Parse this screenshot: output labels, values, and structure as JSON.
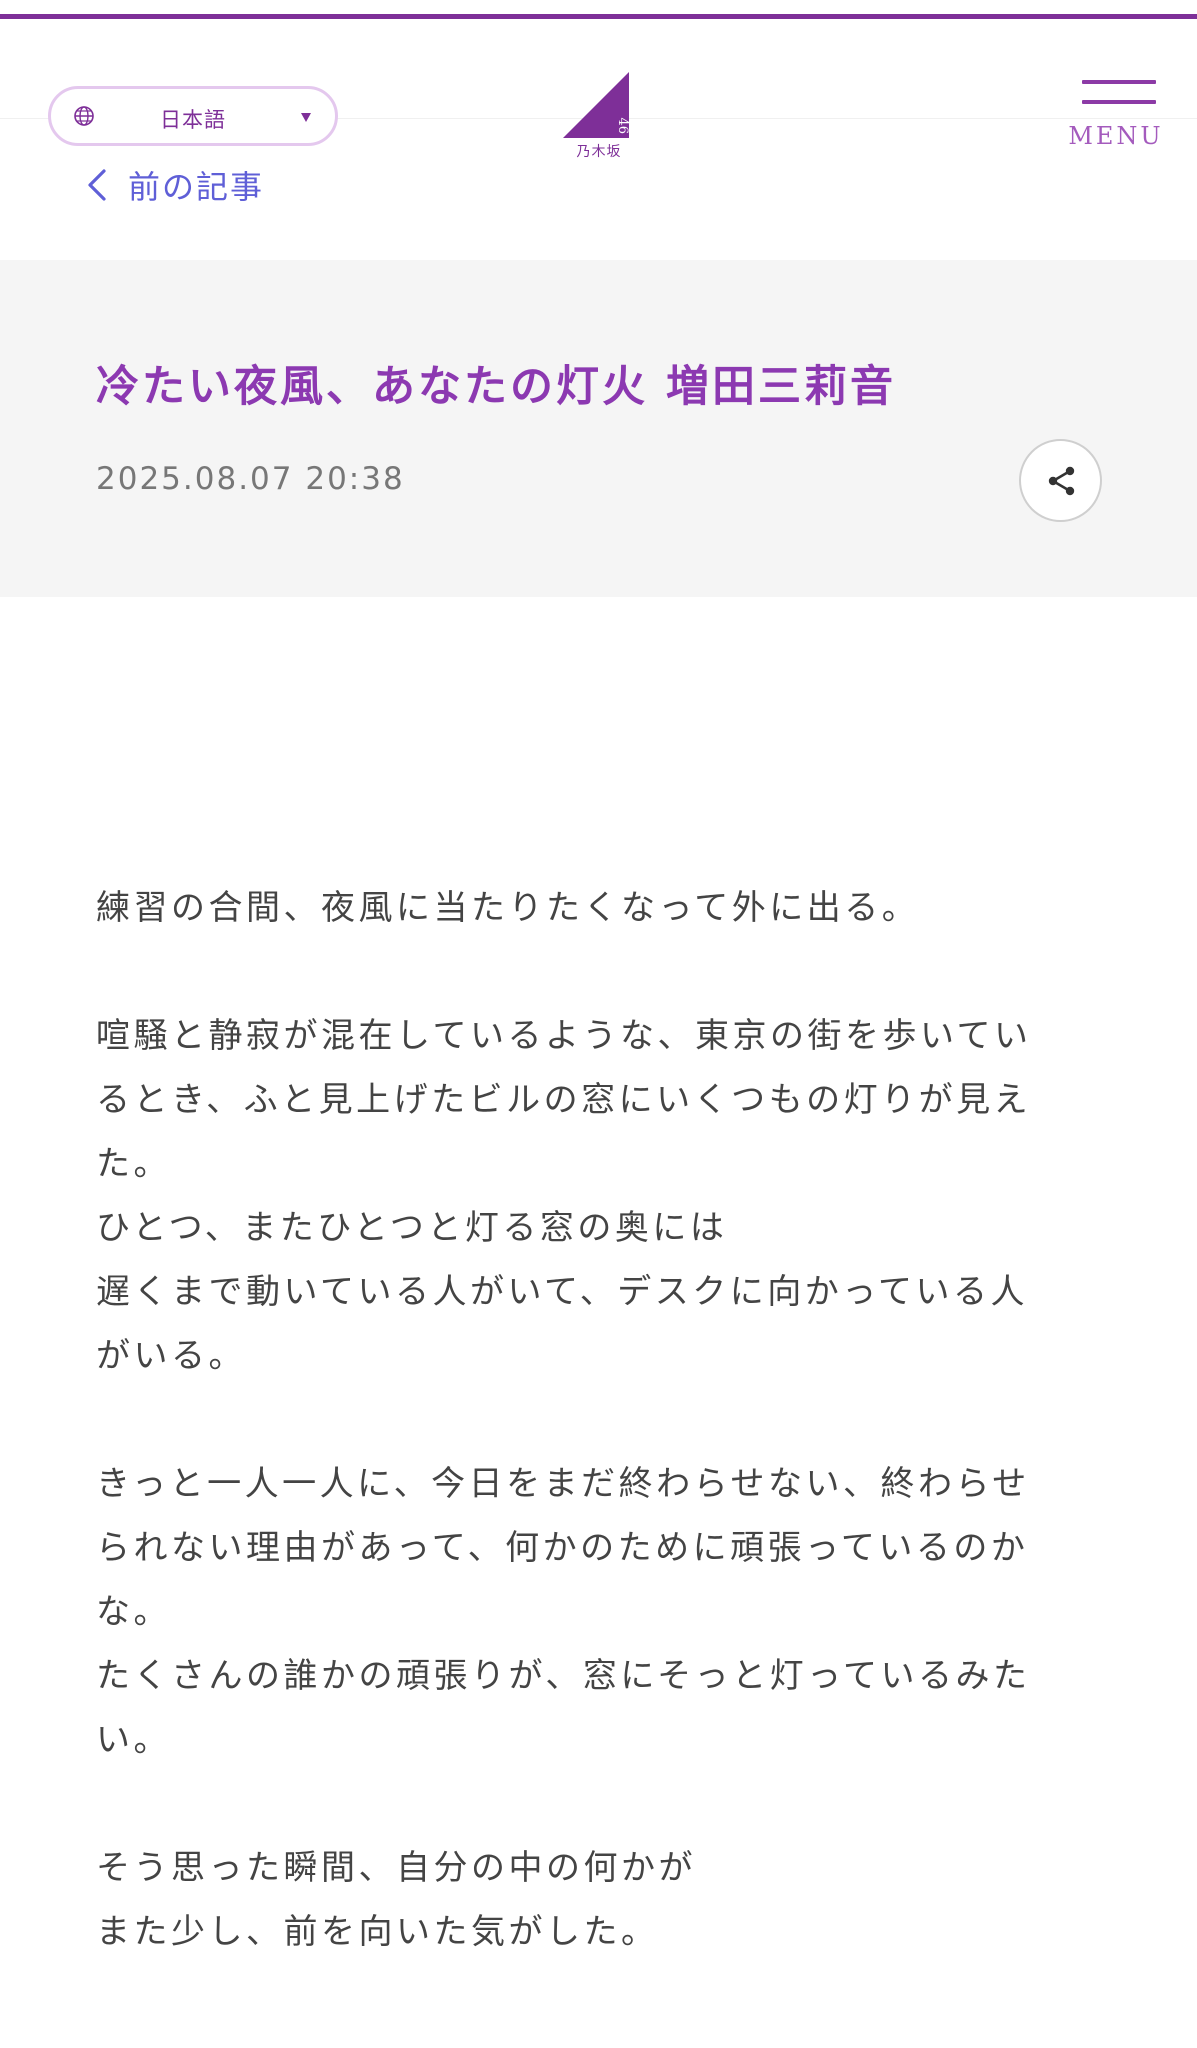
{
  "header": {
    "language_label": "日本語",
    "logo_text": "乃木坂",
    "logo_number": "46",
    "menu_label": "MENU"
  },
  "nav": {
    "prev_article_label": "前の記事"
  },
  "article": {
    "title": "冷たい夜風、あなたの灯火 増田三莉音",
    "date": "2025.08.07 20:38",
    "body_lines": [
      "練習の合間、夜風に当たりたくなって外に出る。",
      "",
      "喧騒と静寂が混在しているような、東京の街を歩いてい",
      "るとき、ふと見上げたビルの窓にいくつもの灯りが見え",
      "た。",
      "ひとつ、またひとつと灯る窓の奥には",
      "遅くまで動いている人がいて、デスクに向かっている人",
      "がいる。",
      "",
      "きっと一人一人に、今日をまだ終わらせない、終わらせ",
      "られない理由があって、何かのために頑張っているのか",
      "な。",
      "たくさんの誰かの頑張りが、窓にそっと灯っているみた",
      "い。",
      "",
      "そう思った瞬間、自分の中の何かが",
      "また少し、前を向いた気がした。"
    ]
  },
  "colors": {
    "brand_purple": "#7e2f98",
    "title_purple": "#8c39b1",
    "link_blue": "#5f5fd7",
    "band_gray": "#f5f5f5"
  },
  "icons": {
    "language": "globe-icon",
    "language_toggle": "caret-down-icon",
    "prev": "chevron-left-icon",
    "share": "share-icon",
    "menu": "hamburger-icon"
  }
}
